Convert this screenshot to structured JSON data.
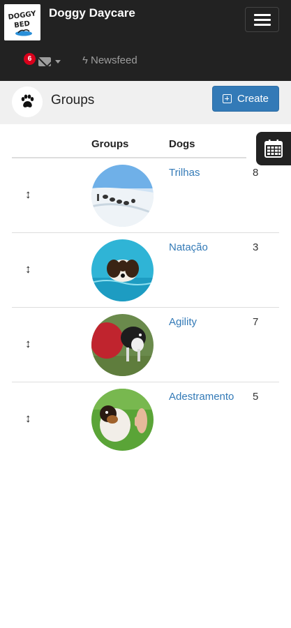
{
  "navbar": {
    "brand": "Doggy Daycare",
    "logo_alt": "DOGGY BED",
    "messages_badge": "6",
    "newsfeed_label": "Newsfeed",
    "bg_color": "#222222"
  },
  "header": {
    "title": "Groups",
    "create_label": "Create",
    "icon": "paw-icon"
  },
  "table": {
    "columns": [
      "Groups",
      "Dogs"
    ],
    "rows": [
      {
        "name": "Trilhas",
        "dogs": "8",
        "image": "sled-dogs-snow"
      },
      {
        "name": "Natação",
        "dogs": "3",
        "image": "dog-swimming"
      },
      {
        "name": "Agility",
        "dogs": "7",
        "image": "border-collie-agility"
      },
      {
        "name": "Adestramento",
        "dogs": "5",
        "image": "dog-high-five"
      }
    ]
  },
  "colors": {
    "accent": "#337ab7",
    "badge": "#d9001b"
  }
}
